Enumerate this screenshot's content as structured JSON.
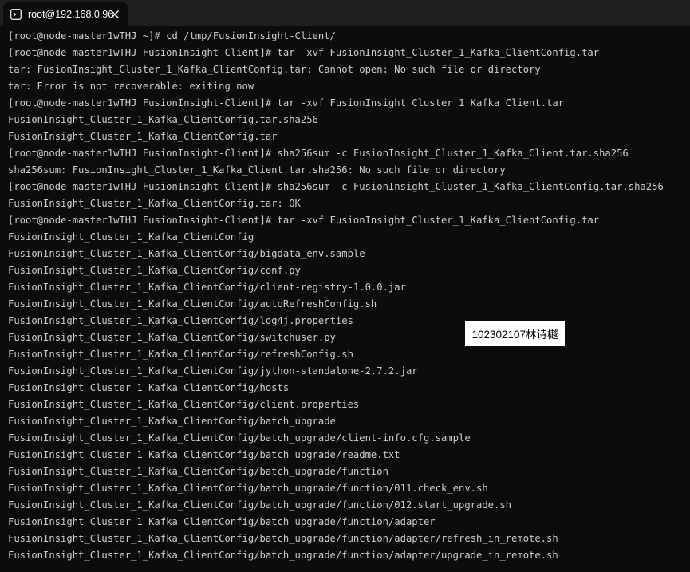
{
  "tab": {
    "title": "root@192.168.0.96",
    "icon": "terminal-icon",
    "close_icon": "close-icon"
  },
  "terminal": {
    "lines": [
      "[root@node-master1wTHJ ~]# cd /tmp/FusionInsight-Client/",
      "[root@node-master1wTHJ FusionInsight-Client]# tar -xvf FusionInsight_Cluster_1_Kafka_ClientConfig.tar",
      "tar: FusionInsight_Cluster_1_Kafka_ClientConfig.tar: Cannot open: No such file or directory",
      "tar: Error is not recoverable: exiting now",
      "[root@node-master1wTHJ FusionInsight-Client]# tar -xvf FusionInsight_Cluster_1_Kafka_Client.tar",
      "FusionInsight_Cluster_1_Kafka_ClientConfig.tar.sha256",
      "FusionInsight_Cluster_1_Kafka_ClientConfig.tar",
      "[root@node-master1wTHJ FusionInsight-Client]# sha256sum -c FusionInsight_Cluster_1_Kafka_Client.tar.sha256",
      "sha256sum: FusionInsight_Cluster_1_Kafka_Client.tar.sha256: No such file or directory",
      "[root@node-master1wTHJ FusionInsight-Client]# sha256sum -c FusionInsight_Cluster_1_Kafka_ClientConfig.tar.sha256",
      "FusionInsight_Cluster_1_Kafka_ClientConfig.tar: OK",
      "[root@node-master1wTHJ FusionInsight-Client]# tar -xvf FusionInsight_Cluster_1_Kafka_ClientConfig.tar",
      "FusionInsight_Cluster_1_Kafka_ClientConfig",
      "FusionInsight_Cluster_1_Kafka_ClientConfig/bigdata_env.sample",
      "FusionInsight_Cluster_1_Kafka_ClientConfig/conf.py",
      "FusionInsight_Cluster_1_Kafka_ClientConfig/client-registry-1.0.0.jar",
      "FusionInsight_Cluster_1_Kafka_ClientConfig/autoRefreshConfig.sh",
      "FusionInsight_Cluster_1_Kafka_ClientConfig/log4j.properties",
      "FusionInsight_Cluster_1_Kafka_ClientConfig/switchuser.py",
      "FusionInsight_Cluster_1_Kafka_ClientConfig/refreshConfig.sh",
      "FusionInsight_Cluster_1_Kafka_ClientConfig/jython-standalone-2.7.2.jar",
      "FusionInsight_Cluster_1_Kafka_ClientConfig/hosts",
      "FusionInsight_Cluster_1_Kafka_ClientConfig/client.properties",
      "FusionInsight_Cluster_1_Kafka_ClientConfig/batch_upgrade",
      "FusionInsight_Cluster_1_Kafka_ClientConfig/batch_upgrade/client-info.cfg.sample",
      "FusionInsight_Cluster_1_Kafka_ClientConfig/batch_upgrade/readme.txt",
      "FusionInsight_Cluster_1_Kafka_ClientConfig/batch_upgrade/function",
      "FusionInsight_Cluster_1_Kafka_ClientConfig/batch_upgrade/function/011.check_env.sh",
      "FusionInsight_Cluster_1_Kafka_ClientConfig/batch_upgrade/function/012.start_upgrade.sh",
      "FusionInsight_Cluster_1_Kafka_ClientConfig/batch_upgrade/function/adapter",
      "FusionInsight_Cluster_1_Kafka_ClientConfig/batch_upgrade/function/adapter/refresh_in_remote.sh",
      "FusionInsight_Cluster_1_Kafka_ClientConfig/batch_upgrade/function/adapter/upgrade_in_remote.sh"
    ]
  },
  "watermark": {
    "text": "102302107林诗樾"
  },
  "colors": {
    "background": "#0c0c0c",
    "tabbar": "#1f1f1f",
    "text": "#cccccc"
  }
}
